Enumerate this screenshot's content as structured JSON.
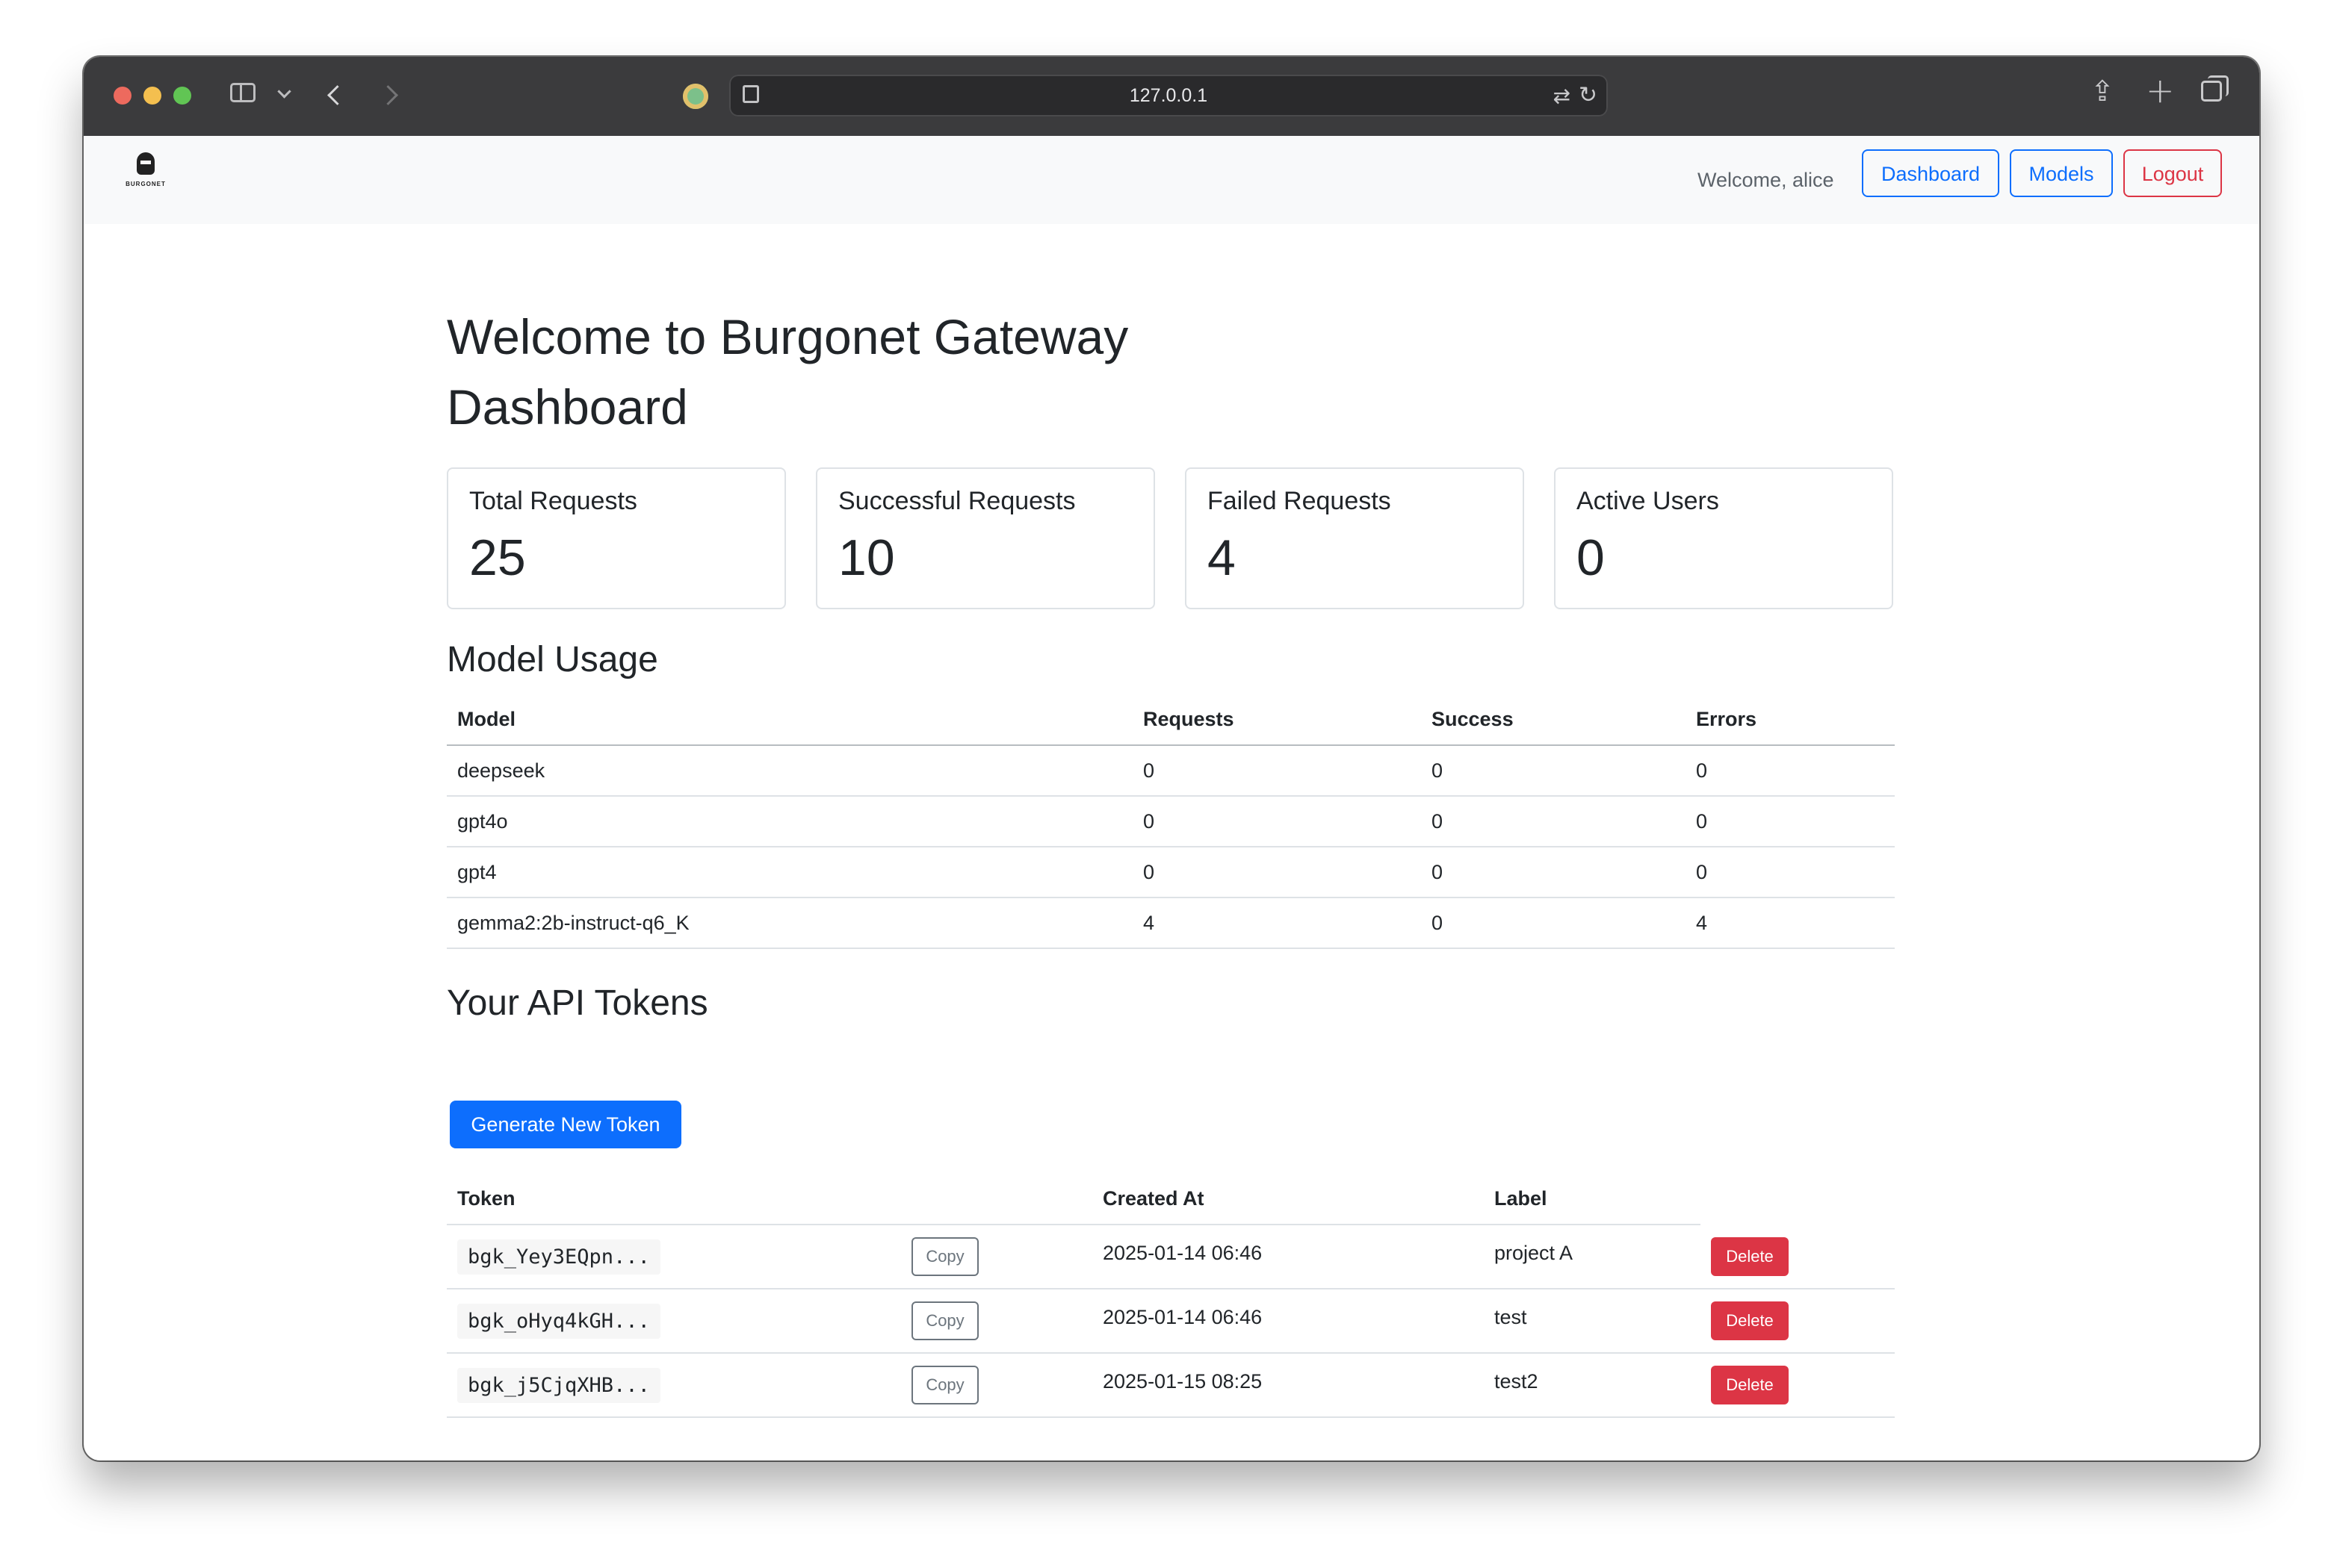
{
  "browser": {
    "url": "127.0.0.1"
  },
  "nav": {
    "logo_text": "BURGONET",
    "welcome": "Welcome, alice",
    "dashboard_label": "Dashboard",
    "models_label": "Models",
    "logout_label": "Logout"
  },
  "page": {
    "title": "Welcome to Burgonet Gateway Dashboard"
  },
  "stats": [
    {
      "title": "Total Requests",
      "value": "25"
    },
    {
      "title": "Successful Requests",
      "value": "10"
    },
    {
      "title": "Failed Requests",
      "value": "4"
    },
    {
      "title": "Active Users",
      "value": "0"
    }
  ],
  "usage": {
    "heading": "Model Usage",
    "columns": [
      "Model",
      "Requests",
      "Success",
      "Errors"
    ],
    "rows": [
      [
        "deepseek",
        "0",
        "0",
        "0"
      ],
      [
        "gpt4o",
        "0",
        "0",
        "0"
      ],
      [
        "gpt4",
        "0",
        "0",
        "0"
      ],
      [
        "gemma2:2b-instruct-q6_K",
        "4",
        "0",
        "4"
      ]
    ]
  },
  "tokens": {
    "heading": "Your API Tokens",
    "generate_label": "Generate New Token",
    "columns": [
      "Token",
      "Created At",
      "Label"
    ],
    "copy_label": "Copy",
    "delete_label": "Delete",
    "rows": [
      {
        "token": "bgk_Yey3EQpn...",
        "created": "2025-01-14 06:46",
        "label": "project A"
      },
      {
        "token": "bgk_oHyq4kGH...",
        "created": "2025-01-14 06:46",
        "label": "test"
      },
      {
        "token": "bgk_j5CjqXHB...",
        "created": "2025-01-15 08:25",
        "label": "test2"
      }
    ]
  }
}
